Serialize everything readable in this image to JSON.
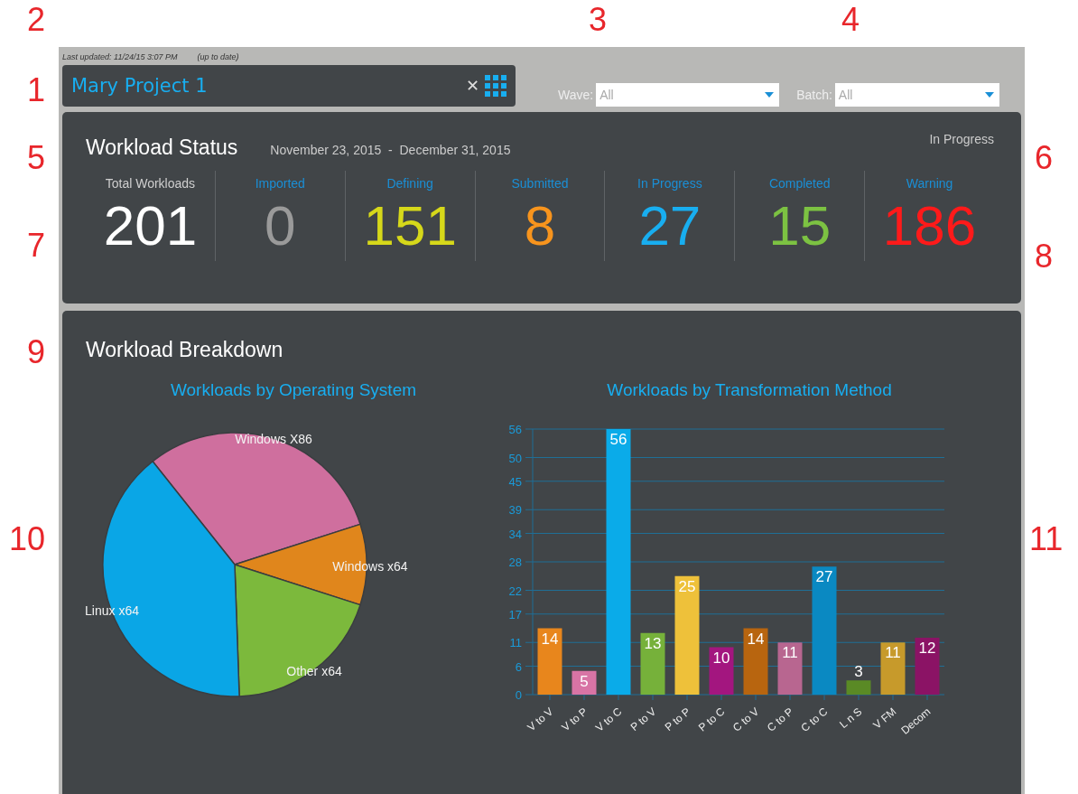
{
  "callouts": [
    "2",
    "3",
    "4",
    "1",
    "5",
    "6",
    "7",
    "8",
    "9",
    "10",
    "11"
  ],
  "header": {
    "last_updated": "Last updated: 11/24/15 3:07 PM",
    "sync_status": "(up to date)",
    "project": "Mary Project 1",
    "close": "✕"
  },
  "filters": [
    {
      "label": "Wave:",
      "value": "All"
    },
    {
      "label": "Batch:",
      "value": "All"
    }
  ],
  "workload_status": {
    "title": "Workload Status",
    "date_range": "November 23, 2015  -  December 31, 2015",
    "state": "In Progress",
    "stats": [
      {
        "kind": "total",
        "label": "Total Workloads",
        "value": "201",
        "color": "#ffffff"
      },
      {
        "kind": "status",
        "label": "Imported",
        "value": "0",
        "color": "#9a9a9a"
      },
      {
        "kind": "status",
        "label": "Defining",
        "value": "151",
        "color": "#d6d81a"
      },
      {
        "kind": "status",
        "label": "Submitted",
        "value": "8",
        "color": "#f7941d"
      },
      {
        "kind": "status",
        "label": "In Progress",
        "value": "27",
        "color": "#18aef0"
      },
      {
        "kind": "status",
        "label": "Completed",
        "value": "15",
        "color": "#7cc242"
      },
      {
        "kind": "status",
        "label": "Warning",
        "value": "186",
        "color": "#ff1a1a"
      }
    ]
  },
  "workload_breakdown": {
    "title": "Workload Breakdown",
    "os_chart": {
      "title": "Workloads by Operating System",
      "slices": [
        {
          "label": "Windows X86",
          "color": "#cf6f9e"
        },
        {
          "label": "Windows x64",
          "color": "#e0861c"
        },
        {
          "label": "Other x64",
          "color": "#7cb93c"
        },
        {
          "label": "Linux x64",
          "color": "#0aa6e6"
        }
      ]
    },
    "method_chart": {
      "title": "Workloads by Transformation Method",
      "bars": [
        {
          "color": "#e8861c"
        },
        {
          "color": "#d874a5"
        },
        {
          "color": "#0aabe9"
        },
        {
          "color": "#76b13a"
        },
        {
          "color": "#eec13a"
        },
        {
          "color": "#a3167f"
        },
        {
          "color": "#b8650f"
        },
        {
          "color": "#b86690"
        },
        {
          "color": "#0a89c2"
        },
        {
          "color": "#5a8a25"
        },
        {
          "color": "#c79a2b"
        },
        {
          "color": "#8b1365"
        }
      ],
      "chart_data": {
        "type": "bar",
        "categories": [
          "V to V",
          "V to P",
          "V to C",
          "P to V",
          "P to P",
          "P to C",
          "C to V",
          "C to P",
          "C to C",
          "L n S",
          "V FM",
          "Decom"
        ],
        "values": [
          14,
          5,
          56,
          13,
          25,
          10,
          14,
          11,
          27,
          3,
          11,
          12
        ],
        "ylim": [
          0,
          56
        ],
        "yticks": [
          0,
          6,
          11,
          17,
          22,
          28,
          34,
          39,
          45,
          50,
          56
        ],
        "data_labels": true,
        "grid": true
      }
    }
  }
}
